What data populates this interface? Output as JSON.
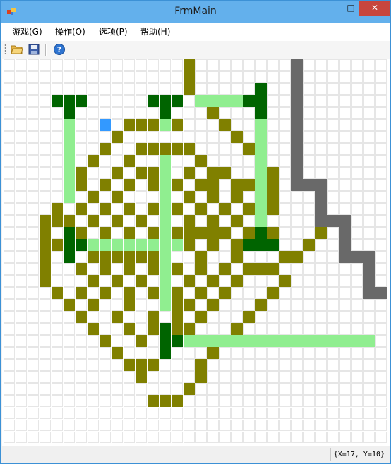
{
  "window": {
    "title": "FrmMain",
    "minimize": "—",
    "maximize": "□",
    "close": "✕"
  },
  "menu": [
    {
      "label": "游戏(G)"
    },
    {
      "label": "操作(O)"
    },
    {
      "label": "选项(P)"
    },
    {
      "label": "帮助(H)"
    }
  ],
  "toolbar": {
    "icons": [
      "open-folder-icon",
      "save-disk-icon",
      "help-icon"
    ]
  },
  "board": {
    "grid_columns": 32,
    "grid_rows": 32,
    "colors": {
      "grid_line": "#e6e6e6",
      "olive": "#808000",
      "light_green": "#90ee90",
      "dark_green": "#006400",
      "gray": "#696969",
      "blue": "#3399ff"
    },
    "cell_groups": {
      "olive": [
        [
          15,
          0
        ],
        [
          15,
          1
        ],
        [
          15,
          2
        ],
        [
          16,
          3
        ],
        [
          17,
          4
        ],
        [
          10,
          5
        ],
        [
          11,
          5
        ],
        [
          12,
          5
        ],
        [
          13,
          5
        ],
        [
          14,
          5
        ],
        [
          18,
          5
        ],
        [
          9,
          6
        ],
        [
          19,
          6
        ],
        [
          11,
          7
        ],
        [
          12,
          7
        ],
        [
          13,
          7
        ],
        [
          14,
          7
        ],
        [
          15,
          7
        ],
        [
          8,
          7
        ],
        [
          20,
          7
        ],
        [
          7,
          8
        ],
        [
          10,
          8
        ],
        [
          16,
          8
        ],
        [
          21,
          8
        ],
        [
          6,
          9
        ],
        [
          9,
          9
        ],
        [
          15,
          9
        ],
        [
          17,
          9
        ],
        [
          11,
          9
        ],
        [
          12,
          9
        ],
        [
          13,
          9
        ],
        [
          18,
          9
        ],
        [
          22,
          9
        ],
        [
          22,
          10
        ],
        [
          6,
          10
        ],
        [
          10,
          10
        ],
        [
          16,
          10
        ],
        [
          17,
          10
        ],
        [
          19,
          10
        ],
        [
          8,
          10
        ],
        [
          12,
          10
        ],
        [
          14,
          10
        ],
        [
          20,
          10
        ],
        [
          5,
          11
        ],
        [
          7,
          11
        ],
        [
          9,
          11
        ],
        [
          13,
          11
        ],
        [
          15,
          11
        ],
        [
          17,
          11
        ],
        [
          19,
          11
        ],
        [
          21,
          11
        ],
        [
          22,
          11
        ],
        [
          4,
          12
        ],
        [
          6,
          12
        ],
        [
          8,
          12
        ],
        [
          10,
          12
        ],
        [
          12,
          12
        ],
        [
          14,
          12
        ],
        [
          16,
          12
        ],
        [
          18,
          12
        ],
        [
          20,
          12
        ],
        [
          22,
          12
        ],
        [
          5,
          13
        ],
        [
          7,
          13
        ],
        [
          9,
          13
        ],
        [
          11,
          13
        ],
        [
          13,
          13
        ],
        [
          15,
          13
        ],
        [
          17,
          13
        ],
        [
          19,
          13
        ],
        [
          21,
          13
        ],
        [
          4,
          13
        ],
        [
          3,
          13
        ],
        [
          3,
          14
        ],
        [
          6,
          14
        ],
        [
          8,
          14
        ],
        [
          10,
          14
        ],
        [
          12,
          14
        ],
        [
          14,
          14
        ],
        [
          15,
          14
        ],
        [
          16,
          14
        ],
        [
          17,
          14
        ],
        [
          18,
          14
        ],
        [
          20,
          14
        ],
        [
          22,
          14
        ],
        [
          4,
          15
        ],
        [
          7,
          15
        ],
        [
          9,
          15
        ],
        [
          11,
          15
        ],
        [
          13,
          15
        ],
        [
          15,
          15
        ],
        [
          17,
          15
        ],
        [
          19,
          15
        ],
        [
          21,
          15
        ],
        [
          3,
          15
        ],
        [
          3,
          16
        ],
        [
          7,
          16
        ],
        [
          8,
          16
        ],
        [
          9,
          16
        ],
        [
          10,
          16
        ],
        [
          11,
          16
        ],
        [
          12,
          16
        ],
        [
          16,
          16
        ],
        [
          19,
          16
        ],
        [
          23,
          16
        ],
        [
          25,
          15
        ],
        [
          26,
          14
        ],
        [
          3,
          17
        ],
        [
          6,
          17
        ],
        [
          8,
          17
        ],
        [
          10,
          17
        ],
        [
          12,
          17
        ],
        [
          14,
          17
        ],
        [
          16,
          17
        ],
        [
          18,
          17
        ],
        [
          20,
          17
        ],
        [
          21,
          17
        ],
        [
          22,
          17
        ],
        [
          24,
          16
        ],
        [
          3,
          18
        ],
        [
          7,
          18
        ],
        [
          9,
          18
        ],
        [
          11,
          18
        ],
        [
          13,
          18
        ],
        [
          15,
          18
        ],
        [
          17,
          18
        ],
        [
          19,
          18
        ],
        [
          23,
          18
        ],
        [
          4,
          19
        ],
        [
          6,
          19
        ],
        [
          8,
          19
        ],
        [
          10,
          19
        ],
        [
          12,
          19
        ],
        [
          14,
          19
        ],
        [
          16,
          19
        ],
        [
          18,
          19
        ],
        [
          22,
          19
        ],
        [
          5,
          20
        ],
        [
          7,
          20
        ],
        [
          10,
          20
        ],
        [
          13,
          20
        ],
        [
          14,
          20
        ],
        [
          15,
          20
        ],
        [
          17,
          20
        ],
        [
          21,
          20
        ],
        [
          6,
          21
        ],
        [
          9,
          21
        ],
        [
          12,
          21
        ],
        [
          14,
          21
        ],
        [
          16,
          21
        ],
        [
          20,
          21
        ],
        [
          7,
          22
        ],
        [
          10,
          22
        ],
        [
          12,
          22
        ],
        [
          13,
          22
        ],
        [
          14,
          22
        ],
        [
          15,
          22
        ],
        [
          19,
          22
        ],
        [
          8,
          23
        ],
        [
          11,
          23
        ],
        [
          18,
          23
        ],
        [
          9,
          24
        ],
        [
          13,
          24
        ],
        [
          17,
          24
        ],
        [
          10,
          25
        ],
        [
          11,
          25
        ],
        [
          12,
          25
        ],
        [
          16,
          25
        ],
        [
          11,
          26
        ],
        [
          16,
          26
        ],
        [
          15,
          27
        ],
        [
          12,
          28
        ],
        [
          13,
          28
        ],
        [
          14,
          28
        ]
      ],
      "light_green": [
        [
          16,
          3
        ],
        [
          17,
          3
        ],
        [
          18,
          3
        ],
        [
          19,
          3
        ],
        [
          5,
          5
        ],
        [
          13,
          5
        ],
        [
          21,
          5
        ],
        [
          5,
          6
        ],
        [
          21,
          6
        ],
        [
          5,
          7
        ],
        [
          21,
          7
        ],
        [
          5,
          8
        ],
        [
          13,
          8
        ],
        [
          21,
          8
        ],
        [
          5,
          9
        ],
        [
          13,
          9
        ],
        [
          21,
          9
        ],
        [
          5,
          10
        ],
        [
          13,
          10
        ],
        [
          21,
          10
        ],
        [
          5,
          11
        ],
        [
          13,
          11
        ],
        [
          21,
          11
        ],
        [
          13,
          12
        ],
        [
          21,
          12
        ],
        [
          13,
          13
        ],
        [
          21,
          13
        ],
        [
          13,
          14
        ],
        [
          21,
          14
        ],
        [
          7,
          15
        ],
        [
          8,
          15
        ],
        [
          9,
          15
        ],
        [
          10,
          15
        ],
        [
          11,
          15
        ],
        [
          12,
          15
        ],
        [
          13,
          15
        ],
        [
          14,
          15
        ],
        [
          13,
          16
        ],
        [
          13,
          17
        ],
        [
          13,
          18
        ],
        [
          13,
          19
        ],
        [
          13,
          20
        ],
        [
          15,
          23
        ],
        [
          16,
          23
        ],
        [
          17,
          23
        ],
        [
          18,
          23
        ],
        [
          19,
          23
        ],
        [
          20,
          23
        ],
        [
          21,
          23
        ],
        [
          22,
          23
        ],
        [
          23,
          23
        ],
        [
          24,
          23
        ],
        [
          25,
          23
        ],
        [
          26,
          23
        ],
        [
          27,
          23
        ],
        [
          28,
          23
        ],
        [
          29,
          23
        ],
        [
          30,
          23
        ]
      ],
      "dark_green": [
        [
          4,
          3
        ],
        [
          5,
          3
        ],
        [
          6,
          3
        ],
        [
          12,
          3
        ],
        [
          13,
          3
        ],
        [
          14,
          3
        ],
        [
          20,
          3
        ],
        [
          21,
          2
        ],
        [
          21,
          3
        ],
        [
          5,
          4
        ],
        [
          13,
          4
        ],
        [
          21,
          4
        ],
        [
          5,
          14
        ],
        [
          21,
          14
        ],
        [
          5,
          15
        ],
        [
          6,
          15
        ],
        [
          20,
          15
        ],
        [
          21,
          15
        ],
        [
          22,
          15
        ],
        [
          5,
          16
        ],
        [
          13,
          22
        ],
        [
          13,
          23
        ],
        [
          14,
          23
        ],
        [
          13,
          24
        ]
      ],
      "gray": [
        [
          24,
          0
        ],
        [
          24,
          1
        ],
        [
          24,
          2
        ],
        [
          24,
          3
        ],
        [
          24,
          4
        ],
        [
          24,
          5
        ],
        [
          24,
          6
        ],
        [
          24,
          7
        ],
        [
          24,
          8
        ],
        [
          24,
          9
        ],
        [
          24,
          10
        ],
        [
          25,
          10
        ],
        [
          26,
          10
        ],
        [
          26,
          11
        ],
        [
          26,
          12
        ],
        [
          26,
          13
        ],
        [
          27,
          13
        ],
        [
          28,
          13
        ],
        [
          28,
          14
        ],
        [
          28,
          15
        ],
        [
          28,
          16
        ],
        [
          29,
          16
        ],
        [
          30,
          16
        ],
        [
          30,
          17
        ],
        [
          30,
          18
        ],
        [
          30,
          19
        ],
        [
          31,
          19
        ]
      ],
      "blue": [
        [
          8,
          5
        ]
      ]
    }
  },
  "status": {
    "coords": "{X=17, Y=10}"
  }
}
